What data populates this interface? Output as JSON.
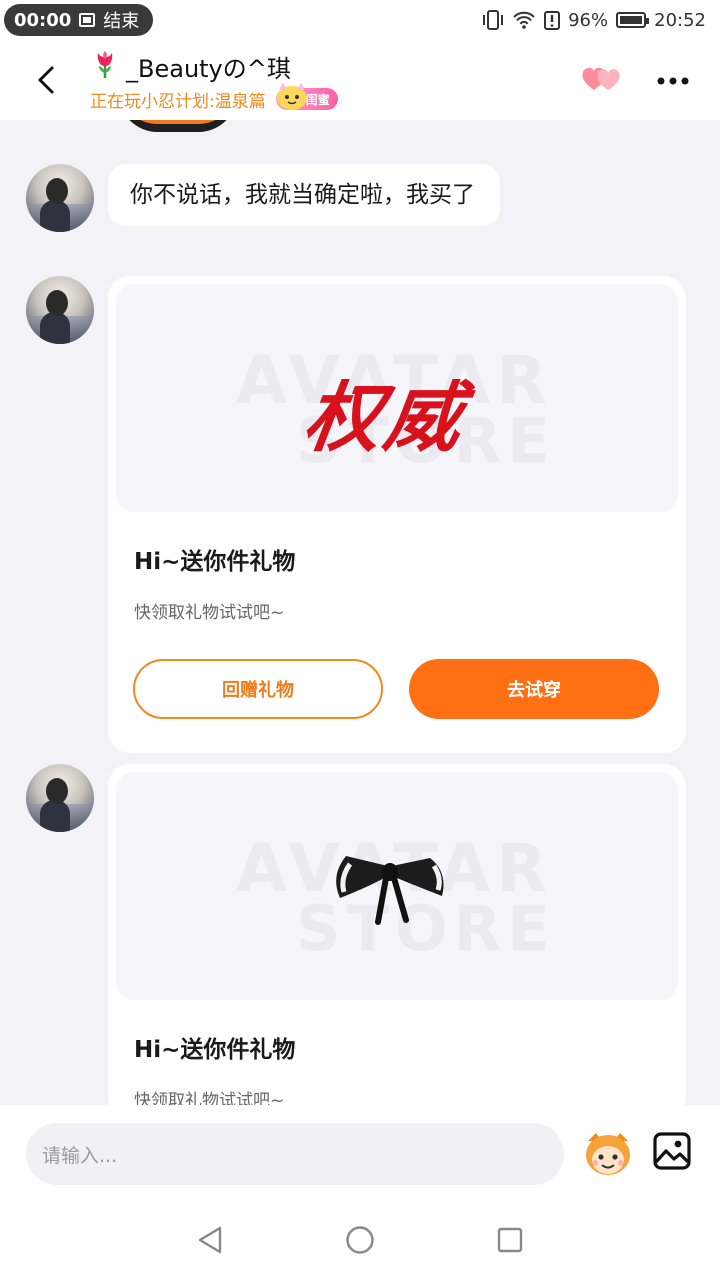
{
  "status_bar": {
    "carrier": "无",
    "recording_time": "00:00",
    "recording_action": "结束",
    "battery": "96%",
    "clock": "20:52"
  },
  "header": {
    "title": "_Beautyの^琪",
    "subtitle": "正在玩小忍计划:温泉篇",
    "badge": "闺蜜"
  },
  "messages": [
    {
      "type": "text",
      "text": "你不说话，我就当确定啦，我买了"
    },
    {
      "type": "gift",
      "image_text": "权威",
      "title": "Hi~送你件礼物",
      "desc": "快领取礼物试试吧~",
      "return_label": "回赠礼物",
      "try_label": "去试穿"
    },
    {
      "type": "gift",
      "title": "Hi~送你件礼物",
      "desc": "快领取礼物试试吧~"
    }
  ],
  "watermark": {
    "line1": "AVATAR",
    "line2": "STORE"
  },
  "input": {
    "placeholder": "请输入..."
  },
  "colors": {
    "accent": "#ff7014",
    "accent_text": "#f08a1c",
    "badge": "#ff5fa8",
    "background": "#f3f2f7"
  }
}
